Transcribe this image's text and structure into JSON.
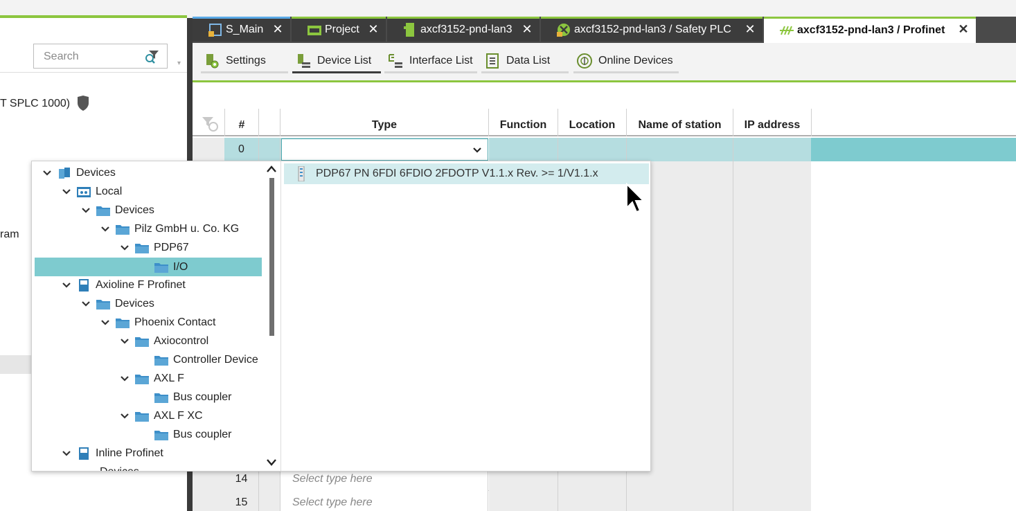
{
  "left_panel": {
    "search_placeholder": "Search",
    "text_line_1": "T SPLC 1000)",
    "text_line_2": "ram"
  },
  "tabs": [
    {
      "label": "S_Main",
      "icon": "plc-program-icon"
    },
    {
      "label": "Project",
      "icon": "project-icon"
    },
    {
      "label": "axcf3152-pnd-lan3",
      "icon": "controller-icon"
    },
    {
      "label": "axcf3152-pnd-lan3 / Safety PLC",
      "icon": "safety-plc-icon"
    },
    {
      "label": "axcf3152-pnd-lan3 / Profinet",
      "icon": "profinet-icon",
      "active": true
    }
  ],
  "toolbar": {
    "settings": "Settings",
    "device_list": "Device List",
    "interface_list": "Interface List",
    "data_list": "Data List",
    "online_devices": "Online Devices"
  },
  "table": {
    "headers": {
      "num": "#",
      "type": "Type",
      "function": "Function",
      "location": "Location",
      "name_of_station": "Name of station",
      "ip_address": "IP address"
    },
    "selected_row_num": "0",
    "rows": [
      {
        "num": "14",
        "type": "Select type here"
      },
      {
        "num": "15",
        "type": "Select type here"
      }
    ]
  },
  "tree": {
    "nodes": [
      {
        "label": "Devices"
      },
      {
        "label": "Local"
      },
      {
        "label": "Devices"
      },
      {
        "label": "Pilz GmbH u. Co. KG"
      },
      {
        "label": "PDP67"
      },
      {
        "label": "I/O"
      },
      {
        "label": "Axioline F Profinet"
      },
      {
        "label": "Devices"
      },
      {
        "label": "Phoenix Contact"
      },
      {
        "label": "Axiocontrol"
      },
      {
        "label": "Controller Device"
      },
      {
        "label": "AXL F"
      },
      {
        "label": "Bus coupler"
      },
      {
        "label": "AXL F XC"
      },
      {
        "label": "Bus coupler"
      },
      {
        "label": "Inline Profinet"
      },
      {
        "label": "Devices"
      }
    ]
  },
  "results": {
    "item_1": "PDP67 PN 6FDI 6FDIO 2FDOTP V1.1.x Rev. >= 1/V1.1.x"
  },
  "colors": {
    "accent_green": "#8cc63f",
    "selection_teal": "#7ecbcf",
    "dark_tab": "#3c3c3c"
  }
}
